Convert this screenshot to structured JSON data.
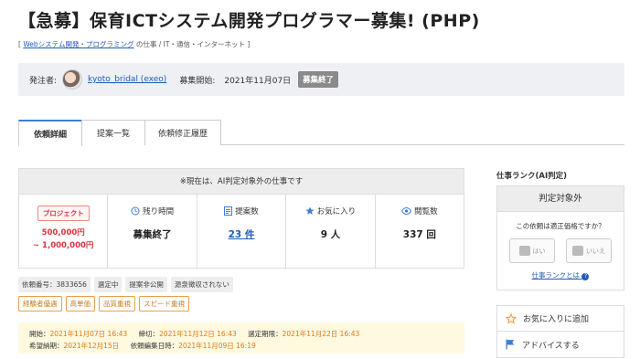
{
  "page": {
    "title": "【急募】保育ICTシステム開発プログラマー募集! (PHP)"
  },
  "breadcrumb": {
    "open": "[",
    "category_link": "Webシステム開発・プログラミング",
    "rest": "の仕事 / IT・通信・インターネット",
    "close": "]"
  },
  "poster": {
    "label": "発注者:",
    "name": "kyoto_bridal (exeo)",
    "start_label": "募集開始:",
    "start_date": "2021年11月07日",
    "status": "募集終了"
  },
  "tabs": [
    {
      "label": "依頼詳細",
      "active": true
    },
    {
      "label": "提案一覧",
      "active": false
    },
    {
      "label": "依頼修正履歴",
      "active": false
    }
  ],
  "panel": {
    "notice": "※現在は、AI判定対象外の仕事です",
    "project_badge": "プロジェクト",
    "budget_min": "500,000円",
    "budget_max": "~ 1,000,000円",
    "remaining_label": "残り時間",
    "remaining_value": "募集終了",
    "proposals_label": "提案数",
    "proposals_value": "23 件",
    "favorites_label": "お気に入り",
    "favorites_value": "9 人",
    "views_label": "閲覧数",
    "views_value": "337 回"
  },
  "tags_info": [
    "依頼番号：3833656",
    "選定中",
    "提案非公開",
    "源泉徴収されない"
  ],
  "tags_features": [
    "経験者優遇",
    "高単価",
    "品質重視",
    "スピード重視"
  ],
  "dates": {
    "start_label": "開始：",
    "start": "2021年11月07日 16:43",
    "deadline_label": "締切：",
    "deadline": "2021年11月12日 16:43",
    "select_label": "選定期限：",
    "select": "2021年11月22日 16:43",
    "delivery_label": "希望納期：",
    "delivery": "2021年12月15日",
    "edited_label": "依頼編集日時：",
    "edited": "2021年11月09日 16:19"
  },
  "sidebar": {
    "rank_title": "仕事ランク(AI判定)",
    "rank_head": "判定対象外",
    "question": "この依頼は適正価格ですか？",
    "yes": "はい",
    "no": "いいえ",
    "rank_link": "仕事ランクとは",
    "add_favorite": "お気に入りに追加",
    "advise": "アドバイスする"
  },
  "colors": {
    "accent_blue": "#1f5bb5",
    "budget_red": "#d9333a",
    "date_orange": "#e07a10",
    "tab_active_border": "#3b7dd8"
  }
}
